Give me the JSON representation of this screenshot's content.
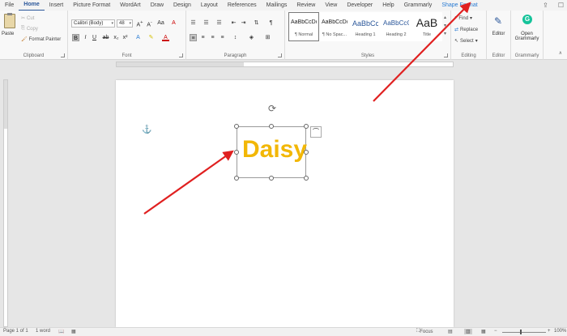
{
  "tabs": [
    "File",
    "Home",
    "Insert",
    "Picture Format",
    "WordArt",
    "Draw",
    "Design",
    "Layout",
    "References",
    "Mailings",
    "Review",
    "View",
    "Developer",
    "Help",
    "Grammarly",
    "Shape Format"
  ],
  "clipboard": {
    "paste": "Paste",
    "cut": "Cut",
    "copy": "Copy",
    "format_painter": "Format Painter",
    "label": "Clipboard"
  },
  "font": {
    "name": "Calibri (Body)",
    "size": "48",
    "label": "Font"
  },
  "paragraph": {
    "label": "Paragraph"
  },
  "styles": {
    "label": "Styles",
    "items": [
      {
        "sample": "AaBbCcDc",
        "name": "¶ Normal"
      },
      {
        "sample": "AaBbCcDc",
        "name": "¶ No Spac..."
      },
      {
        "sample": "AaBbCc",
        "name": "Heading 1"
      },
      {
        "sample": "AaBbCcC",
        "name": "Heading 2"
      },
      {
        "sample": "AaB",
        "name": "Title"
      }
    ]
  },
  "editing": {
    "find": "Find",
    "replace": "Replace",
    "select": "Select",
    "label": "Editing"
  },
  "editor": {
    "btn": "Editor",
    "label": "Editor"
  },
  "grammarly": {
    "btn_line1": "Open",
    "btn_line2": "Grammarly",
    "label": "Grammarly"
  },
  "document": {
    "text": "Daisy"
  },
  "status": {
    "page": "Page 1 of 1",
    "words": "1 word",
    "focus": "Focus",
    "zoom": "100%"
  },
  "colors": {
    "accent": "#2b579a",
    "daisy": "#f2b706",
    "arrow": "#e02020"
  }
}
